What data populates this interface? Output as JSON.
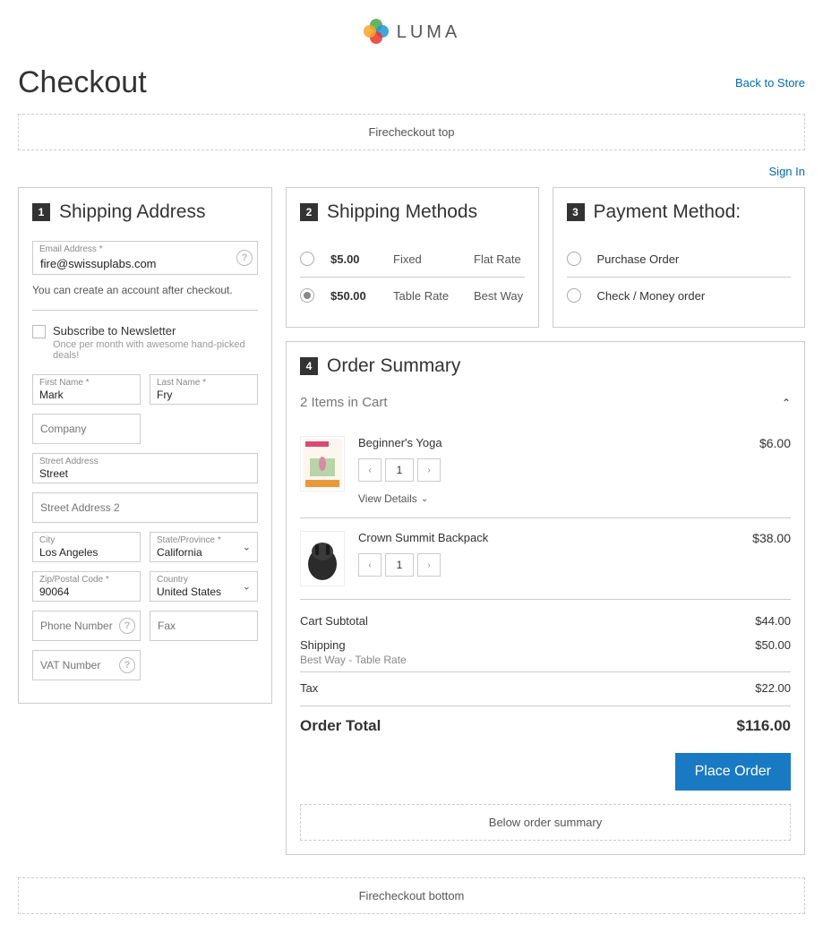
{
  "brand": "LUMA",
  "page_title": "Checkout",
  "back_link": "Back to Store",
  "cms_top": "Firecheckout top",
  "signin": "Sign In",
  "shipping_address": {
    "step": "1",
    "title": "Shipping Address",
    "email_label": "Email Address *",
    "email_value": "fire@swissuplabs.com",
    "account_note": "You can create an account after checkout.",
    "newsletter_label": "Subscribe to Newsletter",
    "newsletter_sub": "Once per month with awesome hand-picked deals!",
    "first_name_label": "First Name *",
    "first_name_value": "Mark",
    "last_name_label": "Last Name *",
    "last_name_value": "Fry",
    "company_ph": "Company",
    "street_label": "Street Address",
    "street_value": "Street",
    "street2_ph": "Street Address 2",
    "city_label": "City",
    "city_value": "Los Angeles",
    "state_label": "State/Province *",
    "state_value": "California",
    "zip_label": "Zip/Postal Code *",
    "zip_value": "90064",
    "country_label": "Country",
    "country_value": "United States",
    "phone_ph": "Phone Number",
    "fax_ph": "Fax",
    "vat_ph": "VAT Number"
  },
  "shipping_methods": {
    "step": "2",
    "title": "Shipping Methods",
    "rows": [
      {
        "price": "$5.00",
        "method": "Fixed",
        "carrier": "Flat Rate",
        "selected": false
      },
      {
        "price": "$50.00",
        "method": "Table Rate",
        "carrier": "Best Way",
        "selected": true
      }
    ]
  },
  "payment": {
    "step": "3",
    "title": "Payment Method:",
    "rows": [
      {
        "label": "Purchase Order",
        "selected": false
      },
      {
        "label": "Check / Money order",
        "selected": false
      }
    ]
  },
  "summary": {
    "step": "4",
    "title": "Order Summary",
    "items_count": "2 Items in Cart",
    "items": [
      {
        "name": "Beginner's Yoga",
        "qty": "1",
        "price": "$6.00",
        "has_details": true,
        "view_details": "View Details"
      },
      {
        "name": "Crown Summit Backpack",
        "qty": "1",
        "price": "$38.00",
        "has_details": false
      }
    ],
    "subtotal_label": "Cart Subtotal",
    "subtotal": "$44.00",
    "shipping_label": "Shipping",
    "shipping_value": "$50.00",
    "shipping_desc": "Best Way - Table Rate",
    "tax_label": "Tax",
    "tax_value": "$22.00",
    "grand_label": "Order Total",
    "grand_value": "$116.00",
    "place_order": "Place Order",
    "below": "Below order summary"
  },
  "cms_bottom": "Firecheckout bottom"
}
